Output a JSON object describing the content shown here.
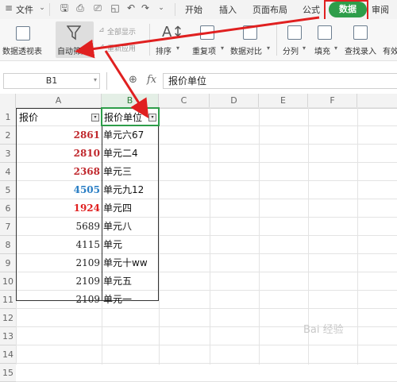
{
  "menu": {
    "file_label": "文件",
    "tabs": [
      "开始",
      "插入",
      "页面布局",
      "公式",
      "数据",
      "审阅"
    ]
  },
  "ribbon": {
    "pivot_label": "数据透视表",
    "autofilter_label": "自动筛选",
    "show_all_label": "全部显示",
    "reapply_label": "重新应用",
    "sort_label": "排序",
    "duplicates_label": "重复项",
    "compare_label": "数据对比",
    "split_label": "分列",
    "fill_label": "填充",
    "lookup_label": "查找录入",
    "valid_label": "有效"
  },
  "formula_bar": {
    "name_box": "B1",
    "fx": "fx",
    "value": "报价单位"
  },
  "columns": [
    "A",
    "B",
    "C",
    "D",
    "E",
    "F"
  ],
  "rows": [
    "1",
    "2",
    "3",
    "4",
    "5",
    "6",
    "7",
    "8",
    "9",
    "10",
    "11",
    "12",
    "13",
    "14",
    "15"
  ],
  "header": {
    "a": "报价",
    "b": "报价单位"
  },
  "data": [
    {
      "a": "2861",
      "b": "单元六67",
      "color": "#c0282d"
    },
    {
      "a": "2810",
      "b": "单元二4",
      "color": "#c0282d"
    },
    {
      "a": "2368",
      "b": "单元三",
      "color": "#c0282d"
    },
    {
      "a": "4505",
      "b": "单元九12",
      "color": "#2a7ec4"
    },
    {
      "a": "1924",
      "b": "单元四",
      "color": "#e02020"
    },
    {
      "a": "5689",
      "b": "单元八",
      "color": "#222222"
    },
    {
      "a": "4115",
      "b": "单元",
      "color": "#222222"
    },
    {
      "a": "2109",
      "b": "单元十ww",
      "color": "#222222"
    },
    {
      "a": "2109",
      "b": "单元五",
      "color": "#222222"
    },
    {
      "a": "2109",
      "b": "单元一",
      "color": "#222222"
    }
  ],
  "colors": {
    "accent_green": "#2e9d4a",
    "annotation_red": "#e02020"
  },
  "watermark": "Bai 经验"
}
